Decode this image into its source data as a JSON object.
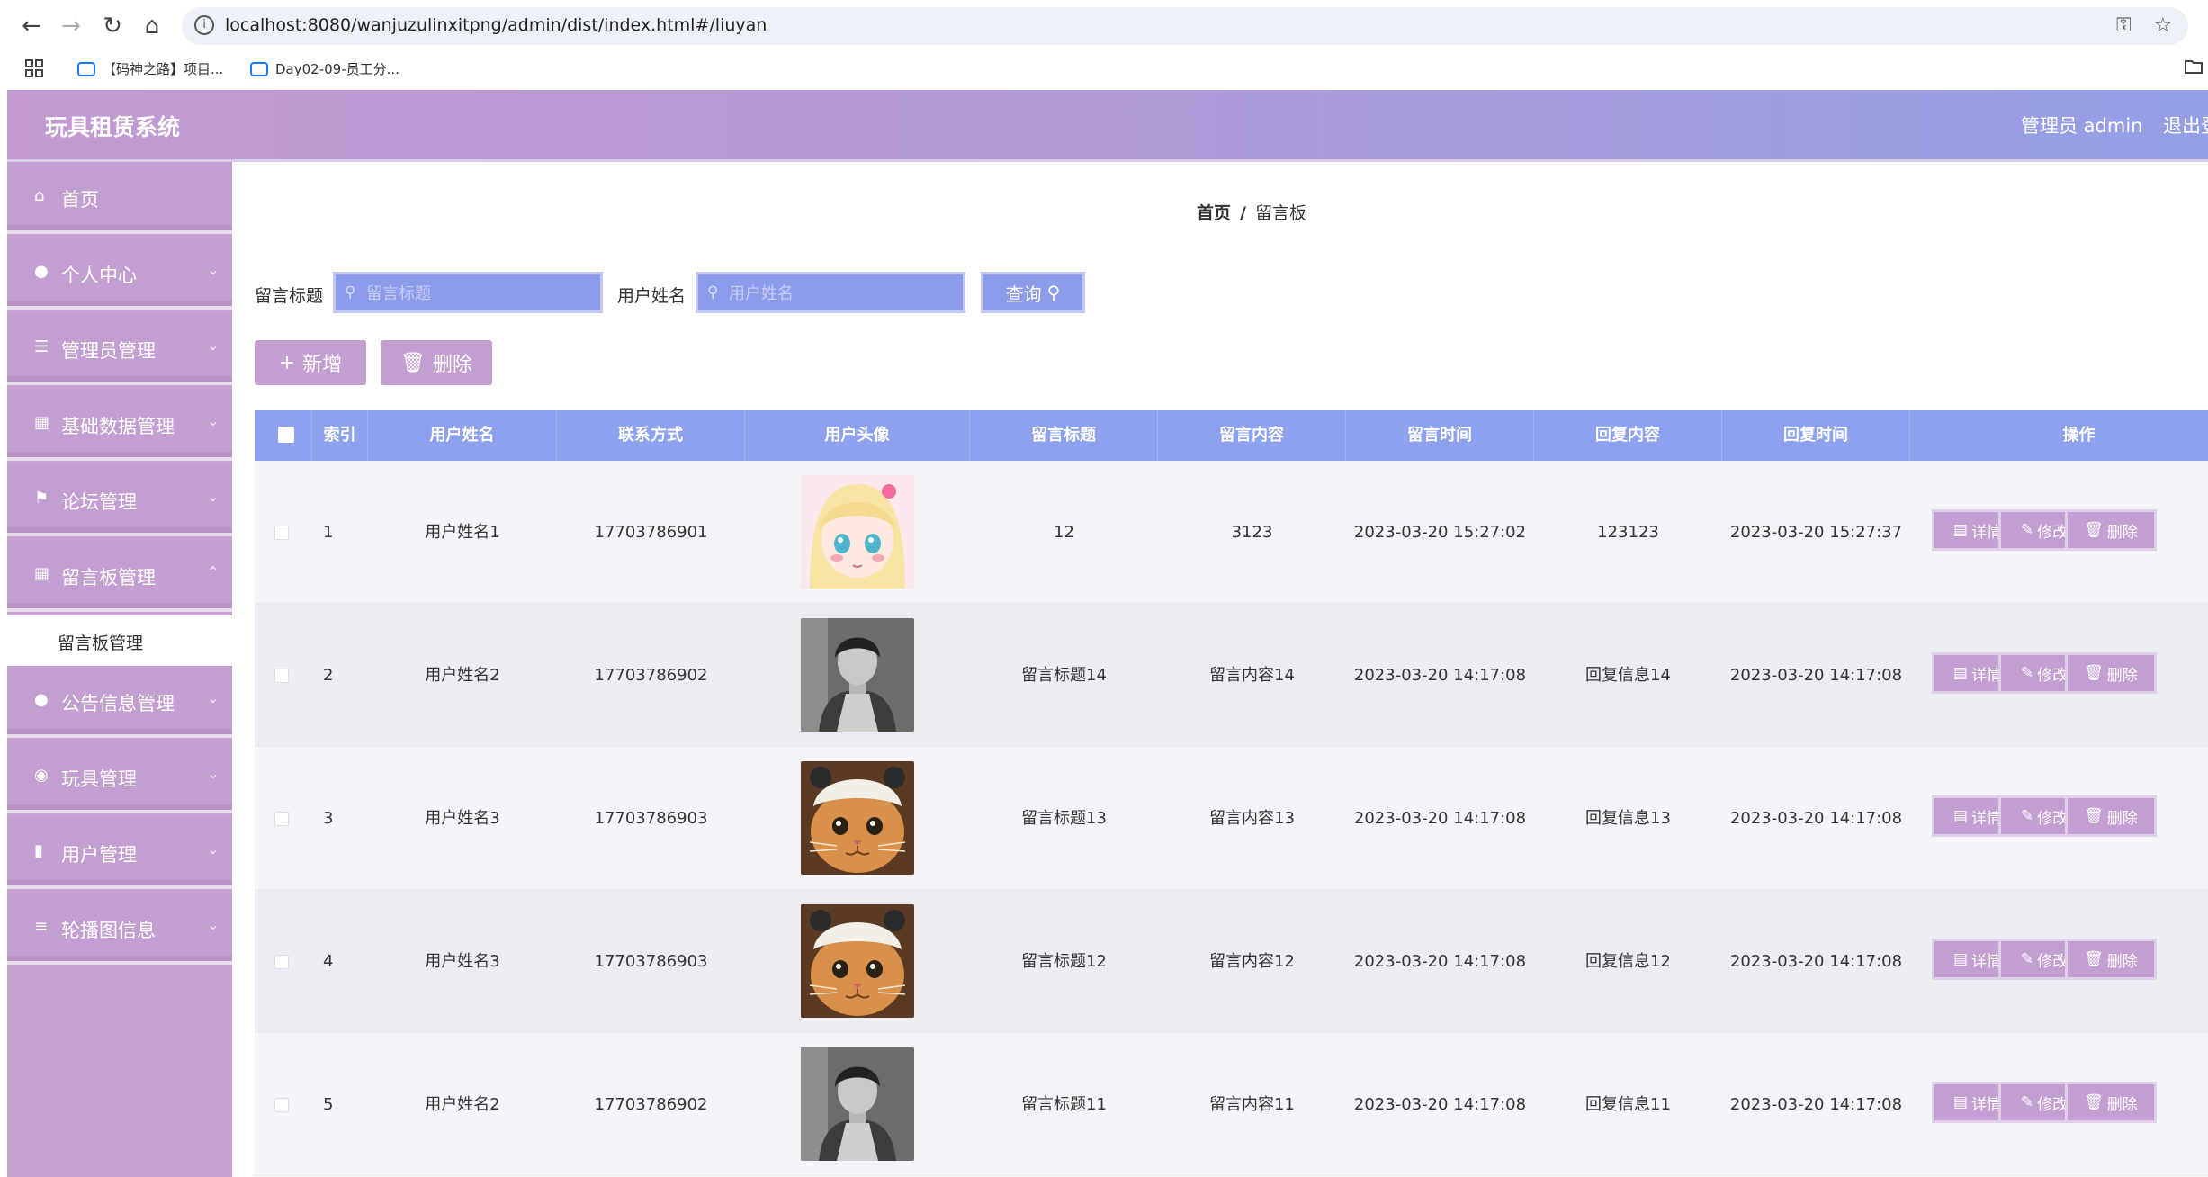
{
  "browser": {
    "url": "localhost:8080/wanjuzulinxitpng/admin/dist/index.html#/liuyan",
    "bookmarks": [
      "【码神之路】项目...",
      "Day02-09-员工分..."
    ]
  },
  "header": {
    "title": "玩具租赁系统",
    "user": "管理员 admin",
    "logout": "退出登"
  },
  "sidebar": {
    "items": [
      {
        "label": "首页",
        "icon": "home-icon"
      },
      {
        "label": "个人中心",
        "icon": "user-icon"
      },
      {
        "label": "管理员管理",
        "icon": "sliders-icon"
      },
      {
        "label": "基础数据管理",
        "icon": "grid-icon"
      },
      {
        "label": "论坛管理",
        "icon": "flag-icon"
      },
      {
        "label": "留言板管理",
        "icon": "grid-icon"
      },
      {
        "label": "公告信息管理",
        "icon": "user-icon"
      },
      {
        "label": "玩具管理",
        "icon": "pin-icon"
      },
      {
        "label": "用户管理",
        "icon": "bar-chart-icon"
      },
      {
        "label": "轮播图信息",
        "icon": "menu-icon"
      }
    ],
    "submenu": "留言板管理"
  },
  "breadcrumb": {
    "home": "首页",
    "sep": "/",
    "current": "留言板"
  },
  "search": {
    "title_label": "留言标题",
    "title_placeholder": "留言标题",
    "name_label": "用户姓名",
    "name_placeholder": "用户姓名",
    "query": "查询"
  },
  "actions": {
    "add": "新增",
    "delete": "删除"
  },
  "table": {
    "headers": [
      "索引",
      "用户姓名",
      "联系方式",
      "用户头像",
      "留言标题",
      "留言内容",
      "留言时间",
      "回复内容",
      "回复时间",
      "操作"
    ],
    "ops": {
      "detail": "详情",
      "edit": "修改",
      "delete": "删除"
    },
    "rows": [
      {
        "index": "1",
        "name": "用户姓名1",
        "phone": "17703786901",
        "avatar": "anime-girl",
        "title": "12",
        "content": "3123",
        "time": "2023-03-20 15:27:02",
        "reply": "123123",
        "reply_time": "2023-03-20 15:27:37"
      },
      {
        "index": "2",
        "name": "用户姓名2",
        "phone": "17703786902",
        "avatar": "man-photo",
        "title": "留言标题14",
        "content": "留言内容14",
        "time": "2023-03-20 14:17:08",
        "reply": "回复信息14",
        "reply_time": "2023-03-20 14:17:08"
      },
      {
        "index": "3",
        "name": "用户姓名3",
        "phone": "17703786903",
        "avatar": "cat-photo",
        "title": "留言标题13",
        "content": "留言内容13",
        "time": "2023-03-20 14:17:08",
        "reply": "回复信息13",
        "reply_time": "2023-03-20 14:17:08"
      },
      {
        "index": "4",
        "name": "用户姓名3",
        "phone": "17703786903",
        "avatar": "cat-photo",
        "title": "留言标题12",
        "content": "留言内容12",
        "time": "2023-03-20 14:17:08",
        "reply": "回复信息12",
        "reply_time": "2023-03-20 14:17:08"
      },
      {
        "index": "5",
        "name": "用户姓名2",
        "phone": "17703786902",
        "avatar": "man-photo",
        "title": "留言标题11",
        "content": "留言内容11",
        "time": "2023-03-20 14:17:08",
        "reply": "回复信息11",
        "reply_time": "2023-03-20 14:17:08"
      }
    ]
  },
  "colors": {
    "accent": "#c39ed0",
    "table_header": "#8da1ee",
    "search_field": "#8c9bea"
  }
}
